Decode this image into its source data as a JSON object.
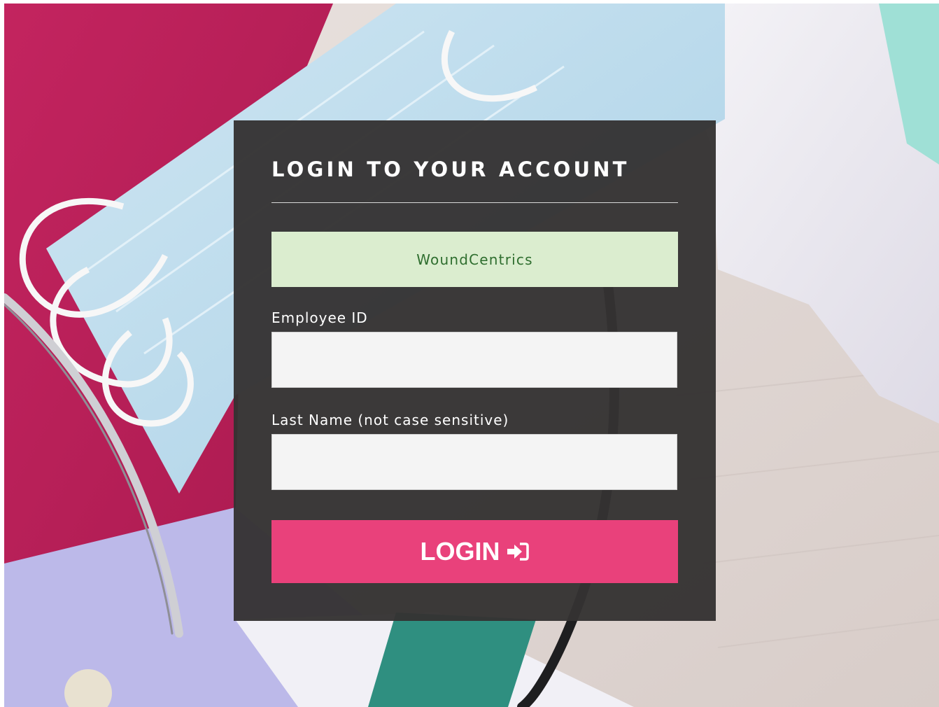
{
  "login": {
    "title": "LOGIN TO YOUR ACCOUNT",
    "organization": "WoundCentrics",
    "employee_id_label": "Employee ID",
    "employee_id_value": "",
    "last_name_label": "Last Name (not case sensitive)",
    "last_name_value": "",
    "button_label": "LOGIN",
    "button_icon": "sign-in-icon"
  },
  "colors": {
    "panel": "#343232",
    "org_box": "#dbedcf",
    "org_text": "#2f6e2f",
    "button": "#e9417b",
    "input_bg": "#f4f4f4"
  }
}
